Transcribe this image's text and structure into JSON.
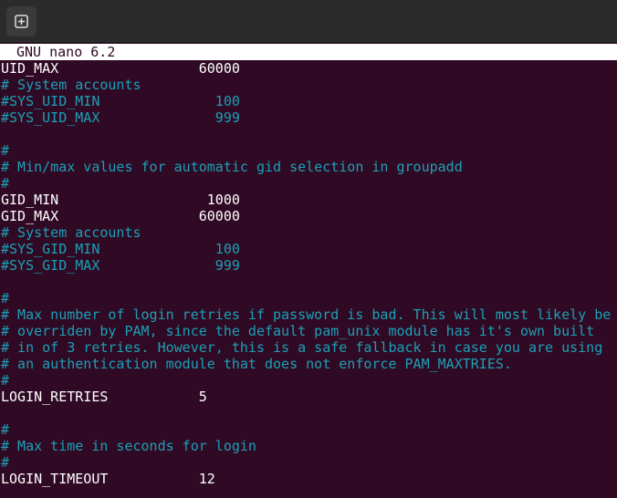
{
  "window": {
    "new_tab_icon": "new-tab-icon"
  },
  "nano": {
    "header": "GNU nano 6.2"
  },
  "lines": [
    {
      "text": "UID_MAX                 60000",
      "kind": "normal"
    },
    {
      "text": "# System accounts",
      "kind": "comment"
    },
    {
      "text": "#SYS_UID_MIN              100",
      "kind": "comment"
    },
    {
      "text": "#SYS_UID_MAX              999",
      "kind": "comment"
    },
    {
      "text": "",
      "kind": "normal"
    },
    {
      "text": "#",
      "kind": "comment"
    },
    {
      "text": "# Min/max values for automatic gid selection in groupadd",
      "kind": "comment"
    },
    {
      "text": "#",
      "kind": "comment"
    },
    {
      "text": "GID_MIN                  1000",
      "kind": "normal"
    },
    {
      "text": "GID_MAX                 60000",
      "kind": "normal"
    },
    {
      "text": "# System accounts",
      "kind": "comment"
    },
    {
      "text": "#SYS_GID_MIN              100",
      "kind": "comment"
    },
    {
      "text": "#SYS_GID_MAX              999",
      "kind": "comment"
    },
    {
      "text": "",
      "kind": "normal"
    },
    {
      "text": "#",
      "kind": "comment"
    },
    {
      "text": "# Max number of login retries if password is bad. This will most likely be",
      "kind": "comment"
    },
    {
      "text": "# overriden by PAM, since the default pam_unix module has it's own built",
      "kind": "comment"
    },
    {
      "text": "# in of 3 retries. However, this is a safe fallback in case you are using",
      "kind": "comment"
    },
    {
      "text": "# an authentication module that does not enforce PAM_MAXTRIES.",
      "kind": "comment"
    },
    {
      "text": "#",
      "kind": "comment"
    },
    {
      "text": "LOGIN_RETRIES           5",
      "kind": "normal"
    },
    {
      "text": "",
      "kind": "normal"
    },
    {
      "text": "#",
      "kind": "comment"
    },
    {
      "text": "# Max time in seconds for login",
      "kind": "comment"
    },
    {
      "text": "#",
      "kind": "comment"
    },
    {
      "text": "LOGIN_TIMEOUT           12",
      "kind": "normal"
    }
  ],
  "colors": {
    "background": "#300a24",
    "comment": "#1ba0b6",
    "text": "#ffffff",
    "header_bg": "#ffffff"
  }
}
